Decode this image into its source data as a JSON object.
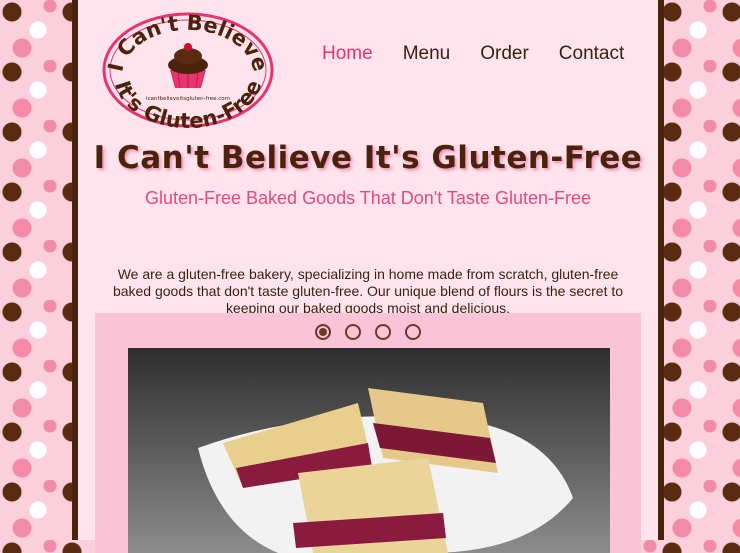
{
  "logo": {
    "top_text": "I Can't Believe",
    "bottom_text": "It's Gluten-Free",
    "url_text": "icantbelieveitsgluten-free.com"
  },
  "nav": {
    "items": [
      {
        "label": "Home",
        "active": true
      },
      {
        "label": "Menu",
        "active": false
      },
      {
        "label": "Order",
        "active": false
      },
      {
        "label": "Contact",
        "active": false
      }
    ]
  },
  "hero": {
    "title": "I Can't Believe It's Gluten-Free",
    "tagline": "Gluten-Free Baked Goods That Don't Taste Gluten-Free"
  },
  "intro": {
    "text": "We are a gluten-free bakery, specializing in home made from scratch, gluten-free baked goods that don't taste gluten-free. Our unique blend of flours is the secret to keeping our baked goods moist and delicious."
  },
  "slider": {
    "slide_count": 4,
    "active_slide": 1,
    "image": "raspberry-bars-on-plate"
  },
  "colors": {
    "accent": "#e8336d",
    "brown": "#4a230c",
    "page_bg": "#ffe4ee",
    "slider_bg": "#fbc3d6"
  }
}
